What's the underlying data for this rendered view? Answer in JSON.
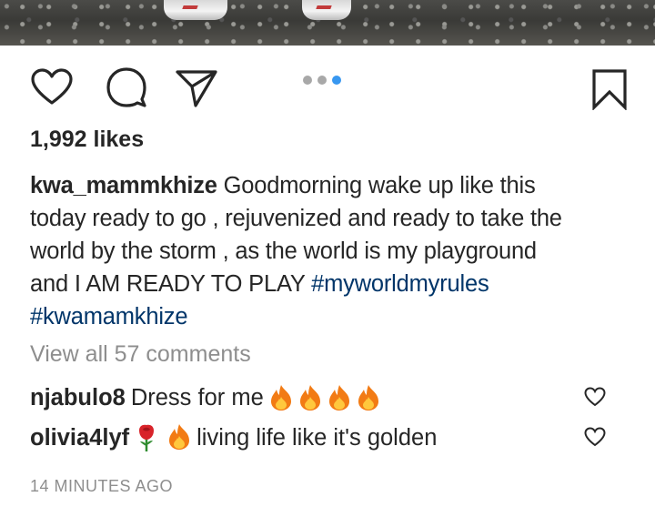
{
  "post": {
    "likes_text": "1,992 likes",
    "caption": {
      "username": "kwa_mammkhize",
      "lines": [
        "Goodmorning wake up like this",
        "today ready to go , rejuvenized and ready to take the",
        "world by the storm , as the world is my playground",
        "and I AM READY TO PLAY "
      ],
      "hashtags": [
        "#myworldmyrules",
        "#kwamamkhize"
      ]
    },
    "view_all_comments": "View all 57 comments",
    "comments": [
      {
        "username": "njabulo8",
        "text": "Dress for me",
        "emojis": [
          "fire",
          "fire",
          "fire",
          "fire"
        ]
      },
      {
        "username": "olivia4lyf",
        "text": "living life like it's golden",
        "emojis": [
          "rose",
          "fire"
        ]
      }
    ],
    "timestamp": "14 MINUTES AGO"
  },
  "carousel": {
    "count": 3,
    "active_index": 2
  },
  "icons": {
    "like": "heart-icon",
    "comment": "comment-bubble-icon",
    "share": "paper-plane-icon",
    "save": "bookmark-icon",
    "comment_like": "heart-outline-icon"
  },
  "colors": {
    "text": "#262626",
    "muted": "#8e8e8e",
    "hashtag": "#003569",
    "active_dot": "#3897f0",
    "inactive_dot": "#a8a8a8"
  }
}
